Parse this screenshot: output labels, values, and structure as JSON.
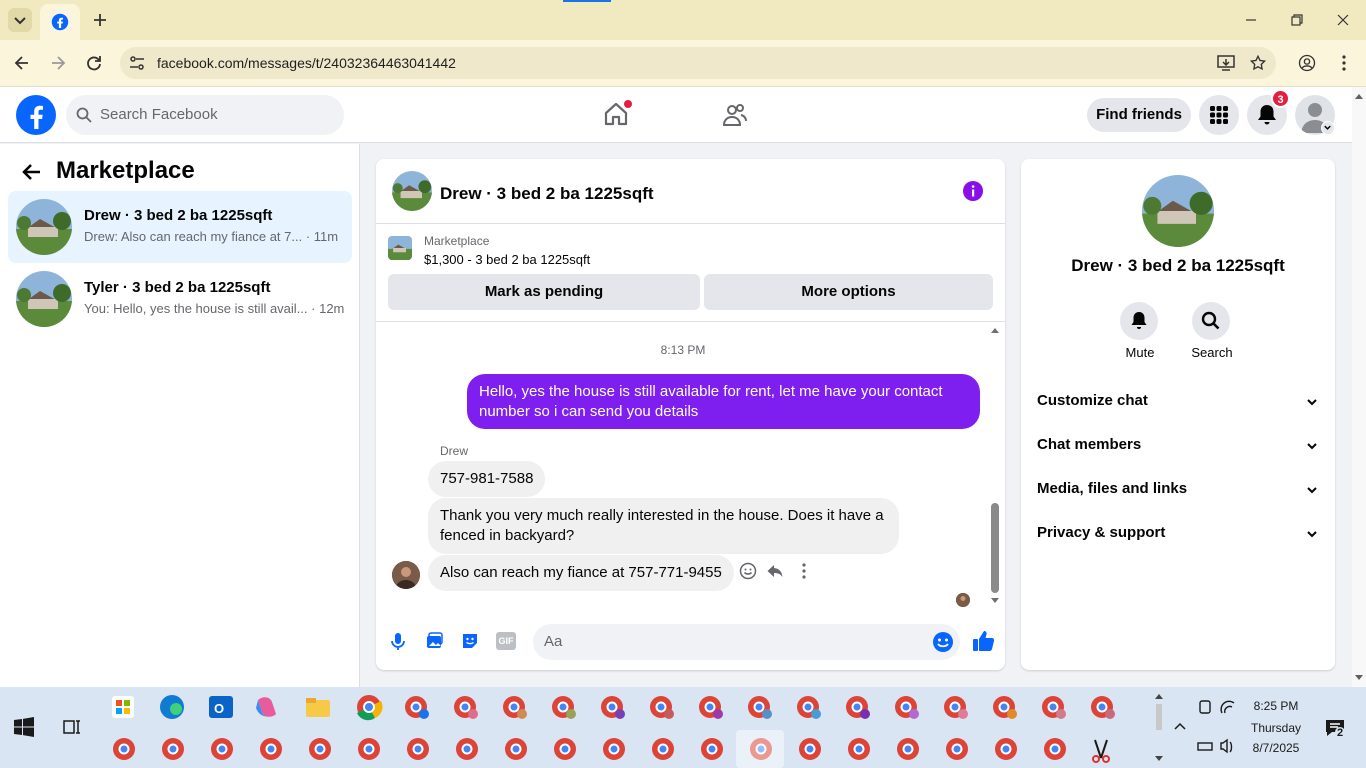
{
  "browser": {
    "url": "facebook.com/messages/t/24032364463041442"
  },
  "fbnav": {
    "search_placeholder": "Search Facebook",
    "find_friends": "Find friends",
    "notification_count": "3"
  },
  "left": {
    "title": "Marketplace",
    "conversations": [
      {
        "name": "Drew · 3 bed 2 ba 1225sqft",
        "snippet": "Drew: Also can reach my fiance at 7...",
        "time": "· 11m",
        "active": true
      },
      {
        "name": "Tyler · 3 bed 2 ba 1225sqft",
        "snippet": "You: Hello, yes the house is still avail...",
        "time": "· 12m",
        "active": false
      }
    ]
  },
  "chat": {
    "title": "Drew · 3 bed 2 ba 1225sqft",
    "listing_label": "Marketplace",
    "listing_price": "$1,300 - 3 bed 2 ba 1225sqft",
    "mark_pending": "Mark as pending",
    "more_options": "More options",
    "timestamp": "8:13 PM",
    "messages": {
      "me1": "Hello, yes the house is still available for rent, let me have your contact number so i can send you  details",
      "sender": "Drew",
      "them1": "757-981-7588",
      "them2": "Thank you very much really interested in the house. Does it have a fenced in backyard?",
      "them3": "Also can reach my fiance at 757-771-9455"
    },
    "composer_placeholder": "Aa",
    "gif_label": "GIF"
  },
  "right": {
    "title": "Drew · 3 bed 2 ba 1225sqft",
    "mute": "Mute",
    "search": "Search",
    "rows": [
      "Customize chat",
      "Chat members",
      "Media, files and links",
      "Privacy & support"
    ]
  },
  "taskbar": {
    "time": "8:25 PM",
    "day": "Thursday",
    "date": "8/7/2025",
    "chat_count": "2"
  },
  "colors": {
    "fb_blue": "#0866ff",
    "messenger_purple": "#7f1fef",
    "badge_red": "#e41e3f"
  }
}
